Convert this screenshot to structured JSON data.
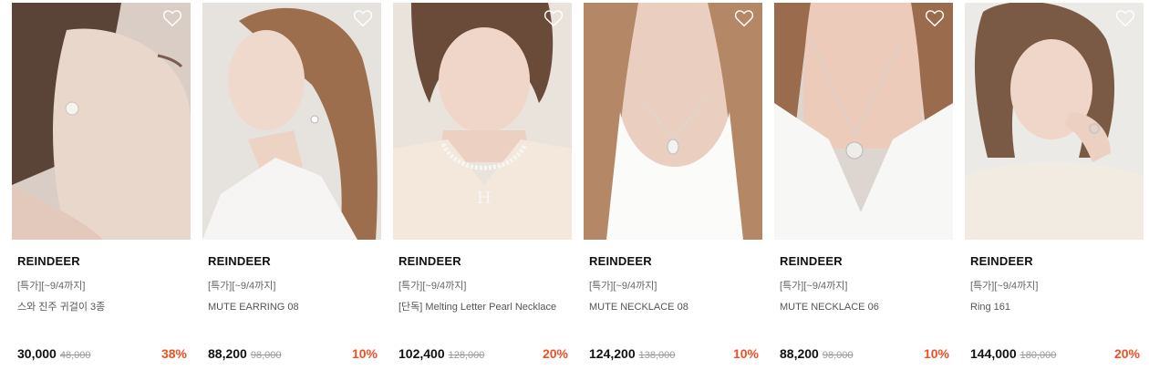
{
  "products": [
    {
      "brand": "REINDEER",
      "promo": "[특가][~9/4까지]",
      "name": "스와 진주 귀걸이 3종",
      "price": "30,000",
      "original_price": "48,000",
      "discount": "38%",
      "wished": false,
      "icon": "heart-outline-icon"
    },
    {
      "brand": "REINDEER",
      "promo": "[특가][~9/4까지]",
      "name": "MUTE EARRING 08",
      "price": "88,200",
      "original_price": "98,000",
      "discount": "10%",
      "wished": false,
      "icon": "heart-outline-icon"
    },
    {
      "brand": "REINDEER",
      "promo": "[특가][~9/4까지]",
      "name": "[단독] Melting Letter Pearl Necklace",
      "price": "102,400",
      "original_price": "128,000",
      "discount": "20%",
      "wished": false,
      "icon": "heart-outline-icon"
    },
    {
      "brand": "REINDEER",
      "promo": "[특가][~9/4까지]",
      "name": "MUTE NECKLACE 08",
      "price": "124,200",
      "original_price": "138,000",
      "discount": "10%",
      "wished": false,
      "icon": "heart-outline-icon"
    },
    {
      "brand": "REINDEER",
      "promo": "[특가][~9/4까지]",
      "name": "MUTE NECKLACE 06",
      "price": "88,200",
      "original_price": "98,000",
      "discount": "10%",
      "wished": false,
      "icon": "heart-outline-icon"
    },
    {
      "brand": "REINDEER",
      "promo": "[특가][~9/4까지]",
      "name": "Ring 161",
      "price": "144,000",
      "original_price": "180,000",
      "discount": "20%",
      "wished": false,
      "icon": "heart-outline-icon"
    }
  ],
  "colors": {
    "discount": "#f04e23",
    "brand_text": "#111111",
    "muted_text": "#999999"
  }
}
